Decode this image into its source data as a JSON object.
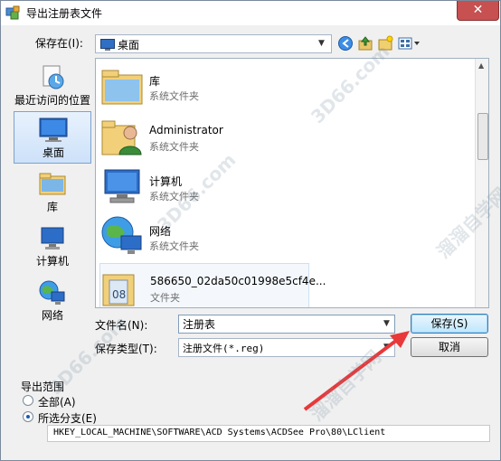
{
  "window": {
    "title": "导出注册表文件",
    "close_label": "✕"
  },
  "toolbar": {
    "save_in_label": "保存在(I):",
    "location": "桌面"
  },
  "places": [
    {
      "label": "最近访问的位置",
      "icon": "recent-places-icon",
      "selected": false
    },
    {
      "label": "桌面",
      "icon": "desktop-icon",
      "selected": true
    },
    {
      "label": "库",
      "icon": "library-icon",
      "selected": false
    },
    {
      "label": "计算机",
      "icon": "computer-icon",
      "selected": false
    },
    {
      "label": "网络",
      "icon": "network-icon",
      "selected": false
    }
  ],
  "files": [
    {
      "name": "库",
      "type": "系统文件夹",
      "icon": "library-folder-icon"
    },
    {
      "name": "Administrator",
      "type": "系统文件夹",
      "icon": "user-folder-icon"
    },
    {
      "name": "计算机",
      "type": "系统文件夹",
      "icon": "computer-icon"
    },
    {
      "name": "网络",
      "type": "系统文件夹",
      "icon": "network-icon"
    },
    {
      "name": "586650_02da50c01998e5cf4e...",
      "type": "文件夹",
      "icon": "folder-icon"
    }
  ],
  "form": {
    "filename_label": "文件名(N):",
    "filename_value": "注册表",
    "filetype_label": "保存类型(T):",
    "filetype_value": "注册文件(*.reg)",
    "save_button": "保存(S)",
    "cancel_button": "取消"
  },
  "export_range": {
    "title": "导出范围",
    "all_label": "全部(A)",
    "selected_label": "所选分支(E)",
    "selected_option": "selected",
    "branch_path": "HKEY_LOCAL_MACHINE\\SOFTWARE\\ACD Systems\\ACDSee Pro\\80\\LClient"
  },
  "watermarks": {
    "text": "3D66.com",
    "cn_text": "溜溜自学网"
  },
  "colors": {
    "accent": "#3c7fb1",
    "annotation_arrow": "#e8383a",
    "close": "#c75050"
  }
}
